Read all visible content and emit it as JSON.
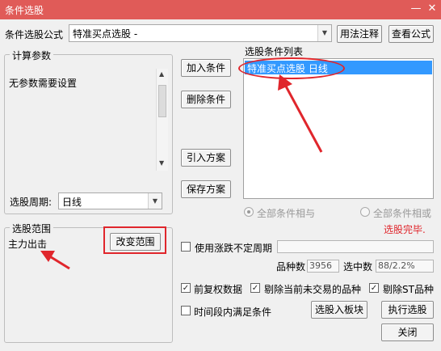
{
  "window": {
    "title": "条件选股",
    "min": "—",
    "close": "✕"
  },
  "formula": {
    "label": "条件选股公式",
    "value": "特准买点选股 -",
    "usage_btn": "用法注释",
    "view_btn": "查看公式"
  },
  "params": {
    "group_title": "计算参数",
    "none_text": "无参数需要设置",
    "period_label": "选股周期:",
    "period_value": "日线"
  },
  "conditions": {
    "add_btn": "加入条件",
    "del_btn": "删除条件",
    "import_btn": "引入方案",
    "save_btn": "保存方案",
    "list_title": "选股条件列表",
    "items": [
      "特准买点选股   日线"
    ]
  },
  "logic": {
    "and_label": "全部条件相与",
    "or_label": "全部条件相或",
    "status": "选股完毕."
  },
  "range": {
    "group_title": "选股范围",
    "value": "主力出击",
    "change_btn": "改变范围"
  },
  "options": {
    "uncertain_period": "使用涨跌不定周期",
    "count_label": "品种数",
    "count_value": "3956",
    "selected_label": "选中数",
    "selected_value": "88/2.2%",
    "adjusted": "前复权数据",
    "exclude_untraded": "剔除当前未交易的品种",
    "exclude_st": "剔除ST品种",
    "period_satisfy": "时间段内满足条件",
    "to_block_btn": "选股入板块",
    "execute_btn": "执行选股",
    "close_btn": "关闭"
  },
  "colors": {
    "title_bar": "#e05b58",
    "selection": "#3399ff",
    "annotation": "#e0262c"
  }
}
